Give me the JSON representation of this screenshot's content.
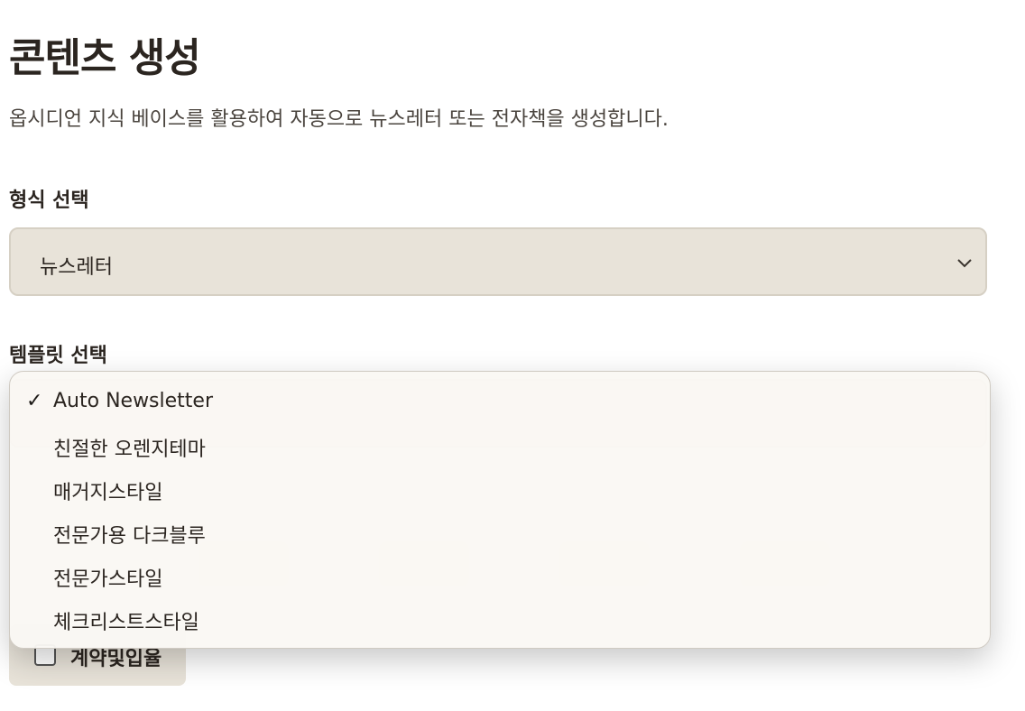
{
  "page": {
    "title": "콘텐츠 생성",
    "subtitle": "옵시디언 지식 베이스를 활용하여 자동으로 뉴스레터 또는 전자책을 생성합니다."
  },
  "format_field": {
    "label": "형식 선택",
    "value": "뉴스레터",
    "icon": "chevron-down-icon"
  },
  "template_field": {
    "label": "템플릿 선택",
    "selected": "Auto Newsletter",
    "options": [
      "Auto Newsletter",
      "친절한 오렌지테마",
      "매거지스타일",
      "전문가용 다크블루",
      "전문가스타일",
      "체크리스트스타일"
    ]
  },
  "checkbox": {
    "label": "계약및입율",
    "checked": false
  }
}
